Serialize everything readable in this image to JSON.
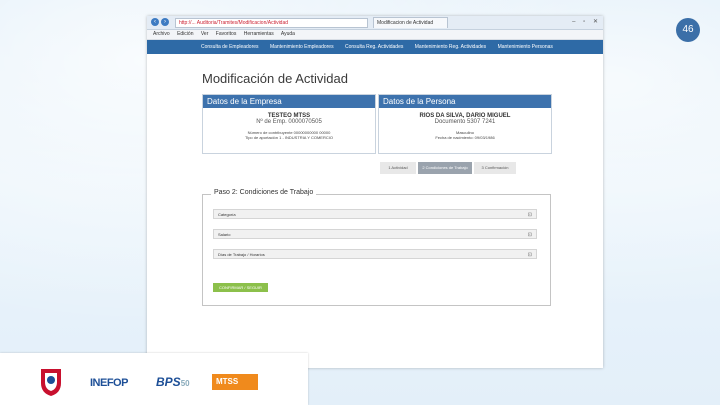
{
  "slide": {
    "number": "46"
  },
  "browser": {
    "address": "http://... Auditoria/Tramites/Modificacion/Actividad",
    "tab_title": "Modificacion de Actividad",
    "menu": [
      "Archivo",
      "Edición",
      "Ver",
      "Favoritos",
      "Herramientas",
      "Ayuda"
    ]
  },
  "app_nav": [
    "Consulta de Empleadores",
    "Mantenimiento Empleadores",
    "Consulta Reg. Actividades",
    "Mantenimiento Reg. Actividades",
    "Mantenimiento Personas"
  ],
  "page": {
    "title": "Modificación de Actividad"
  },
  "empresa": {
    "heading": "Datos de la Empresa",
    "name": "TESTEO MTSS",
    "number": "Nº de Emp. 0000070505",
    "line3": "Número de contribuyente 00000000000 00000",
    "line4": "Tipo de aportación 1 - INDUSTRIA Y COMERCIO"
  },
  "persona": {
    "heading": "Datos de la Persona",
    "name": "RIOS DA SILVA, DARIO MIGUEL",
    "doc": "Documento 5307 7241",
    "line3": "Masculino",
    "line4": "Fecha de nacimiento: 09/03/1986"
  },
  "steps": [
    "1 Actividad",
    "2 Condiciones de Trabajo",
    "3 Confirmación"
  ],
  "form": {
    "legend": "Paso 2: Condiciones de Trabajo",
    "rows": [
      "Categoría",
      "Salario",
      "Días de Trabajo / Horarios"
    ],
    "button": "CONFIRMAR / SEGUIR"
  },
  "footer": {
    "inefop": "INEFOP",
    "bps": "BPS",
    "bps_years": "50",
    "mtss": "MTSS"
  }
}
